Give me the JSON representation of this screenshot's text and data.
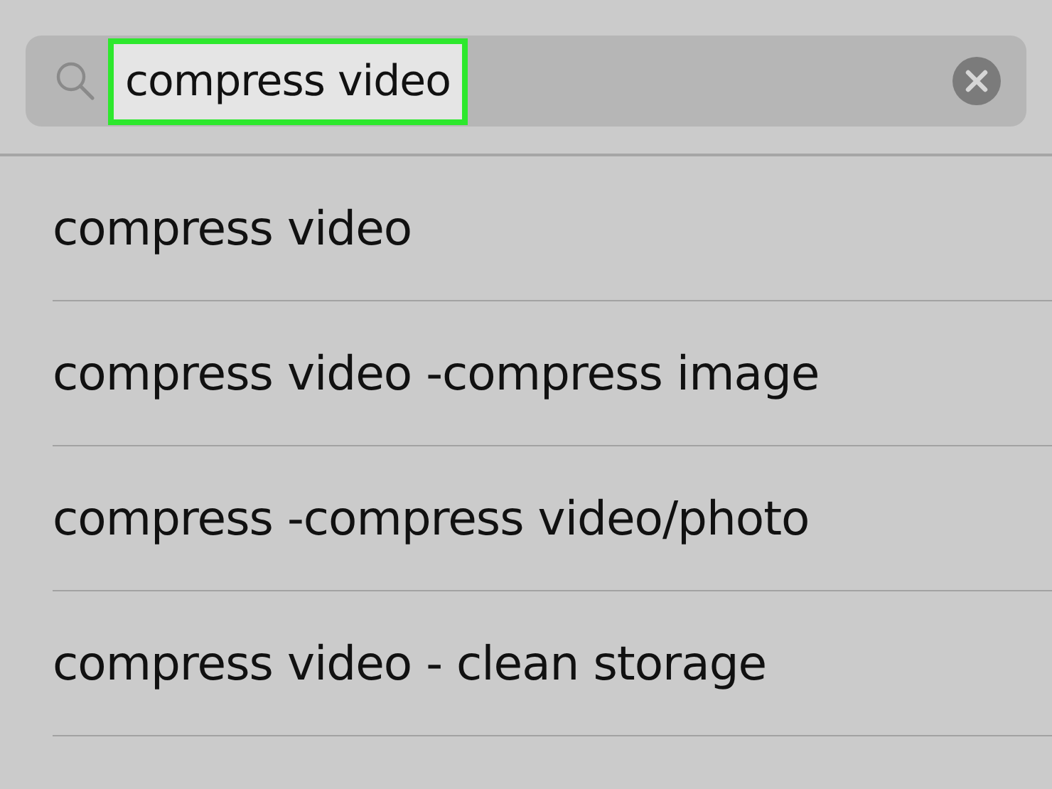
{
  "search": {
    "value": "compress video",
    "highlighted": true
  },
  "suggestions": [
    {
      "text": "compress video"
    },
    {
      "text": "compress video -compress image"
    },
    {
      "text": "compress -compress video/photo"
    },
    {
      "text": "compress video - clean storage"
    }
  ]
}
